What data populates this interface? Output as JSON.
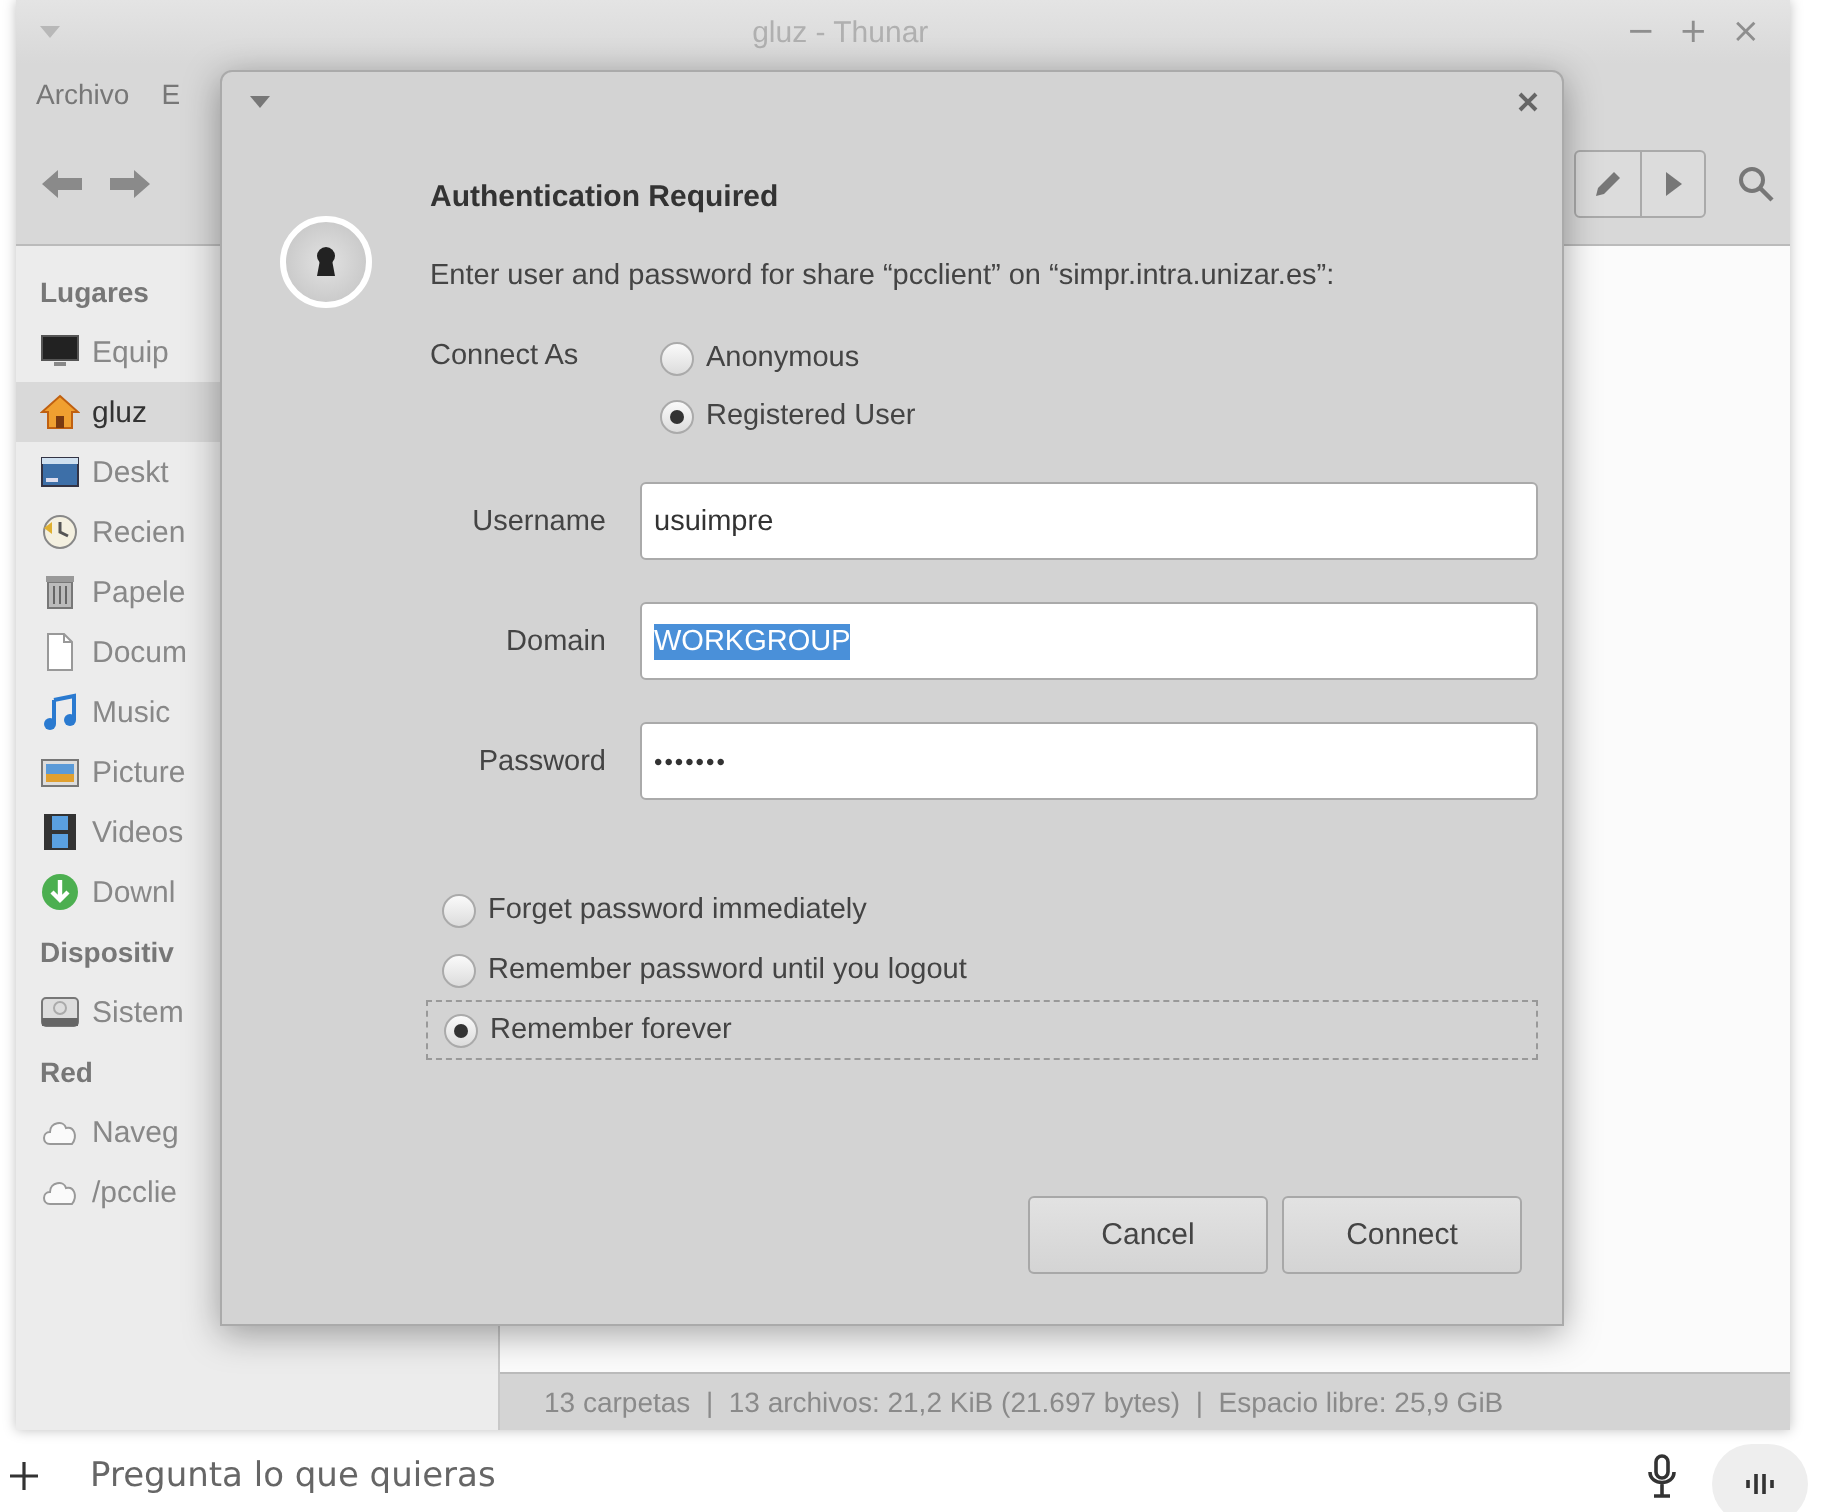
{
  "window": {
    "title": "gluz - Thunar",
    "controls": [
      "−",
      "+",
      "×"
    ]
  },
  "menu": [
    "Archivo",
    "E"
  ],
  "sidebar": {
    "sections": [
      {
        "heading": "Lugares",
        "items": [
          {
            "label": "Equip",
            "kind": "computer",
            "selected": false
          },
          {
            "label": "gluz",
            "kind": "home",
            "selected": true
          },
          {
            "label": "Deskt",
            "kind": "desktop",
            "selected": false
          },
          {
            "label": "Recien",
            "kind": "recent",
            "selected": false
          },
          {
            "label": "Papele",
            "kind": "trash",
            "selected": false
          },
          {
            "label": "Docum",
            "kind": "document",
            "selected": false
          },
          {
            "label": "Music",
            "kind": "music",
            "selected": false
          },
          {
            "label": "Picture",
            "kind": "pictures",
            "selected": false
          },
          {
            "label": "Videos",
            "kind": "videos",
            "selected": false
          },
          {
            "label": "Downl",
            "kind": "downloads",
            "selected": false
          }
        ]
      },
      {
        "heading": "Dispositiv",
        "items": [
          {
            "label": "Sistem",
            "kind": "drive",
            "selected": false
          }
        ]
      },
      {
        "heading": "Red",
        "items": [
          {
            "label": "Naveg",
            "kind": "network",
            "selected": false
          },
          {
            "label": "/pcclie",
            "kind": "network",
            "selected": false
          }
        ]
      }
    ]
  },
  "status_bar": "13 carpetas  |  13 archivos: 21,2 KiB (21.697 bytes)  |  Espacio libre: 25,9 GiB",
  "dialog": {
    "title": "Authentication Required",
    "message": "Enter user and password for share “pcclient” on “simpr.intra.unizar.es”:",
    "connect_as": {
      "label": "Connect As",
      "options": [
        {
          "label": "Anonymous",
          "selected": false
        },
        {
          "label": "Registered User",
          "selected": true
        }
      ]
    },
    "fields": [
      {
        "label": "Username",
        "value": "usuimpre",
        "kind": "text",
        "text_selected": false
      },
      {
        "label": "Domain",
        "value": "WORKGROUP",
        "kind": "text",
        "text_selected": true
      },
      {
        "label": "Password",
        "value": "•••••••",
        "kind": "password",
        "text_selected": false
      }
    ],
    "remember": [
      {
        "label": "Forget password immediately",
        "selected": false,
        "focused": false
      },
      {
        "label": "Remember password until you logout",
        "selected": false,
        "focused": false
      },
      {
        "label": "Remember forever",
        "selected": true,
        "focused": true
      }
    ],
    "buttons": [
      "Cancel",
      "Connect"
    ]
  },
  "prompt_bar": {
    "placeholder": "Pregunta lo que quieras"
  }
}
